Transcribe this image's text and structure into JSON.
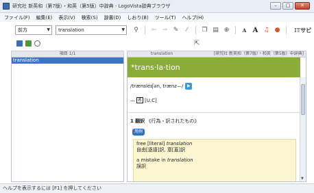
{
  "window": {
    "title": "研究社 新英和（第7版）・和英（第5版）中辞典 - LogoVista辞典ブラウザ",
    "controls": {
      "minimize": "–",
      "maximize": "□",
      "close": "✕"
    }
  },
  "menu": [
    "ファイル(F)",
    "編集(E)",
    "表示(V)",
    "検索(S)",
    "辞書(D)",
    "しおり(B)",
    "ツール(T)",
    "ヘルプ(H)"
  ],
  "toolbar": {
    "search_mode": "前方",
    "search_text": "translation",
    "zoom_text": "𝕀𝕋サビ"
  },
  "left_pane": {
    "header": "項目 1/1",
    "items": [
      {
        "label": "translation",
        "selected": true
      }
    ]
  },
  "right_pane": {
    "header_left": "translation",
    "header_right": "[研究社 新英和（第7版）・和英（第5版）中辞典]",
    "headword": "*trans·la·tion",
    "pronunciation": "/trænsléɪʃən, trænz—/",
    "pos_mark": "名",
    "pos_tags": "[U,C]",
    "sense_number": "1",
    "sense_kw": "翻訳",
    "sense_text": "《行為・訳されたもの》",
    "usage_label": "用例",
    "examples": [
      {
        "en_prefix": "free [literal]",
        "en_word": "translation",
        "ja": "自由[逐語]訳, 意[直]訳"
      },
      {
        "en_prefix": "a mistake in",
        "en_word": "translation",
        "ja": "誤訳"
      }
    ]
  },
  "status": "ヘルプを表示するには [F1] を押してください",
  "colors": {
    "headword_bg": "#8aad3a",
    "selection_bg": "#3d74c4",
    "usage_badge": "#2f6fc2",
    "example_bg": "#fbf6cf"
  }
}
